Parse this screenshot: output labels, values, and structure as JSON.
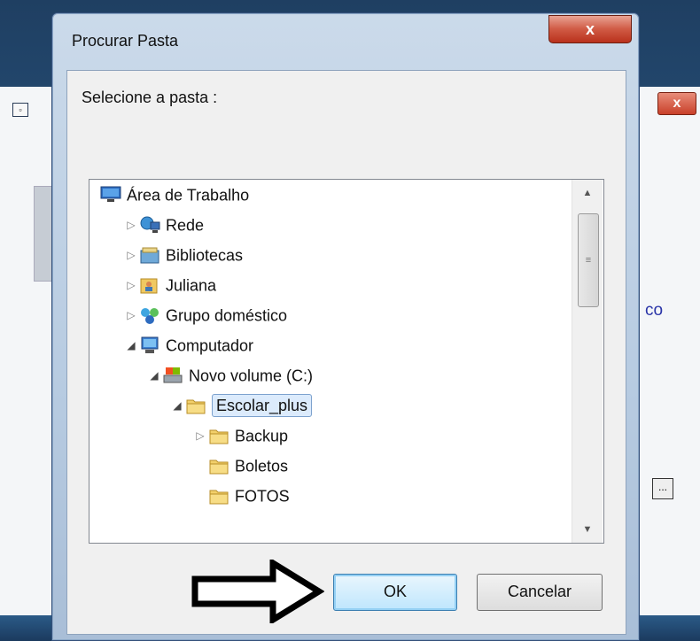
{
  "dialog": {
    "title": "Procurar Pasta",
    "close_glyph": "x",
    "prompt": "Selecione a pasta :"
  },
  "tree": {
    "items": [
      {
        "label": "Área de Trabalho",
        "icon": "desktop-icon",
        "depth": 0,
        "expander": "none"
      },
      {
        "label": "Rede",
        "icon": "network-icon",
        "depth": 1,
        "expander": "collapsed"
      },
      {
        "label": "Bibliotecas",
        "icon": "libraries-icon",
        "depth": 1,
        "expander": "collapsed"
      },
      {
        "label": "Juliana",
        "icon": "user-folder-icon",
        "depth": 1,
        "expander": "collapsed"
      },
      {
        "label": "Grupo doméstico",
        "icon": "homegroup-icon",
        "depth": 1,
        "expander": "collapsed"
      },
      {
        "label": "Computador",
        "icon": "computer-icon",
        "depth": 1,
        "expander": "expanded"
      },
      {
        "label": "Novo volume (C:)",
        "icon": "drive-icon",
        "depth": 2,
        "expander": "expanded"
      },
      {
        "label": "Escolar_plus",
        "icon": "folder-icon",
        "depth": 3,
        "expander": "expanded",
        "selected": true
      },
      {
        "label": "Backup",
        "icon": "folder-icon",
        "depth": 4,
        "expander": "collapsed"
      },
      {
        "label": "Boletos",
        "icon": "folder-icon",
        "depth": 4,
        "expander": "none"
      },
      {
        "label": "FOTOS",
        "icon": "folder-icon",
        "depth": 4,
        "expander": "none"
      }
    ]
  },
  "buttons": {
    "ok": "OK",
    "cancel": "Cancelar"
  },
  "background": {
    "partial_text": "co",
    "ellipsis": "..."
  },
  "colors": {
    "selection": "#dcebfc",
    "close_red": "#c9402a",
    "ok_focus": "#94d0f4"
  }
}
